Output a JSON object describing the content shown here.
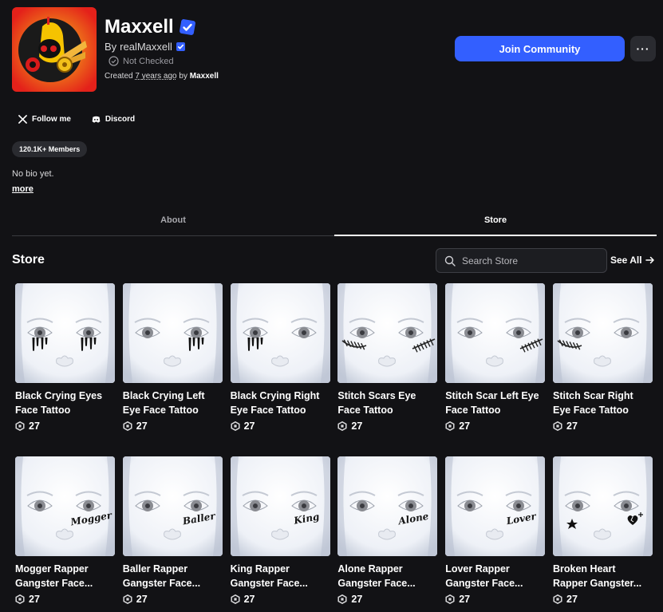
{
  "group": {
    "name": "Maxxell",
    "by_prefix": "By",
    "owner": "realMaxxell",
    "status": "Not Checked",
    "created_prefix": "Created",
    "created_ago": "7 years ago",
    "created_by_prefix": "by",
    "created_by": "Maxxell",
    "join_label": "Join Community",
    "more_label": "···",
    "members": "120.1K+ Members",
    "bio": "No bio yet.",
    "more_link": "more"
  },
  "social": [
    {
      "label": "Follow me",
      "icon": "x-icon"
    },
    {
      "label": "Discord",
      "icon": "discord-icon"
    }
  ],
  "tabs": [
    {
      "label": "About",
      "active": false
    },
    {
      "label": "Store",
      "active": true
    }
  ],
  "store": {
    "title": "Store",
    "search_placeholder": "Search Store",
    "see_all": "See All"
  },
  "items": [
    {
      "name": "Black Crying Eyes Face Tattoo",
      "price": "27",
      "decal": "tears-both"
    },
    {
      "name": "Black Crying Left Eye Face Tattoo",
      "price": "27",
      "decal": "tears-left"
    },
    {
      "name": "Black Crying Right Eye Face Tattoo",
      "price": "27",
      "decal": "tears-right"
    },
    {
      "name": "Stitch Scars Eye Face Tattoo",
      "price": "27",
      "decal": "stitch-both"
    },
    {
      "name": "Stitch Scar Left Eye Face Tattoo",
      "price": "27",
      "decal": "stitch-left"
    },
    {
      "name": "Stitch Scar Right Eye Face Tattoo",
      "price": "27",
      "decal": "stitch-right"
    },
    {
      "name": "Mogger Rapper Gangster Face...",
      "price": "27",
      "decal": "word",
      "word": "Mogger"
    },
    {
      "name": "Baller Rapper Gangster Face...",
      "price": "27",
      "decal": "word",
      "word": "Baller"
    },
    {
      "name": "King Rapper Gangster Face...",
      "price": "27",
      "decal": "word",
      "word": "King"
    },
    {
      "name": "Alone Rapper Gangster Face...",
      "price": "27",
      "decal": "word",
      "word": "Alone"
    },
    {
      "name": "Lover Rapper Gangster Face...",
      "price": "27",
      "decal": "word",
      "word": "Lover"
    },
    {
      "name": "Broken Heart Rapper Gangster...",
      "price": "27",
      "decal": "heart"
    }
  ],
  "colors": {
    "background": "#121215",
    "accent": "#335fff",
    "verified": "#335fff"
  }
}
